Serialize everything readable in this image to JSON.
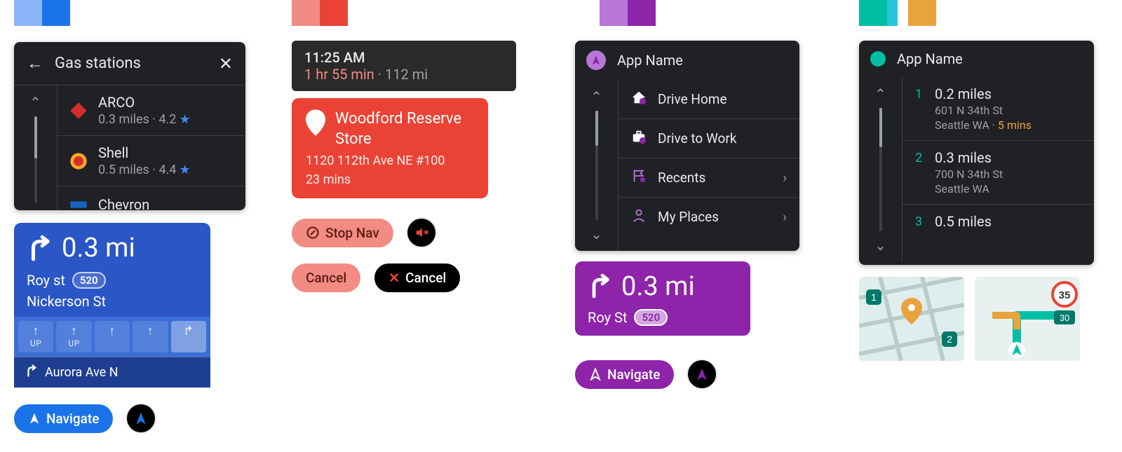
{
  "colors": {
    "blue": "#1a73e8",
    "blue_dark": "#2a56c6",
    "red": "#ea4335",
    "red_soft": "#f28b82",
    "purple": "#8e24aa",
    "purple_light": "#b877d7",
    "teal": "#00bfa5",
    "amber": "#e8a33d"
  },
  "col1": {
    "header_title": "Gas stations",
    "results": [
      {
        "name": "ARCO",
        "sub": "0.3 miles · 4.2",
        "logo_color": "#d32f2f"
      },
      {
        "name": "Shell",
        "sub": "0.5 miles · 4.4",
        "logo_color": "#f9a825"
      },
      {
        "name": "Chevron",
        "sub": "",
        "logo_color": "#1565c0"
      }
    ],
    "nav": {
      "distance": "0.3 mi",
      "street1": "Roy st",
      "route_badge": "520",
      "street2": "Nickerson St",
      "lanes": [
        {
          "arrow": "↑",
          "label": "UP"
        },
        {
          "arrow": "↑",
          "label": "UP"
        },
        {
          "arrow": "↑",
          "label": ""
        },
        {
          "arrow": "↑",
          "label": ""
        },
        {
          "arrow": "↱",
          "label": ""
        }
      ],
      "next_street": "Aurora Ave N"
    },
    "navigate_btn": "Navigate"
  },
  "col2": {
    "time": "11:25 AM",
    "eta": "1 hr 55 min",
    "dist": " · 112 mi",
    "dest_name": "Woodford Reserve Store",
    "dest_addr": "1120 112th Ave NE #100",
    "dest_eta": "23 mins",
    "stop_nav": "Stop Nav",
    "cancel": "Cancel",
    "cancel2": "Cancel"
  },
  "col3": {
    "app_name": "App Name",
    "menu": [
      {
        "label": "Drive Home",
        "icon": "home"
      },
      {
        "label": "Drive to Work",
        "icon": "work"
      },
      {
        "label": "Recents",
        "icon": "flag",
        "chev": true
      },
      {
        "label": "My Places",
        "icon": "person",
        "chev": true
      }
    ],
    "nav_distance": "0.3 mi",
    "nav_street": "Roy St",
    "nav_badge": "520",
    "navigate_btn": "Navigate"
  },
  "col4": {
    "app_name": "App Name",
    "results": [
      {
        "num": "1",
        "title": "0.2 miles",
        "line1": "601 N 34th St",
        "line2": "Seattle WA",
        "eta": "5 mins"
      },
      {
        "num": "2",
        "title": "0.3 miles",
        "line1": "700 N 34th St",
        "line2": "Seattle WA",
        "eta": ""
      },
      {
        "num": "3",
        "title": "0.5 miles",
        "line1": "",
        "line2": "",
        "eta": ""
      }
    ],
    "speed": "35",
    "speed2": "30"
  }
}
